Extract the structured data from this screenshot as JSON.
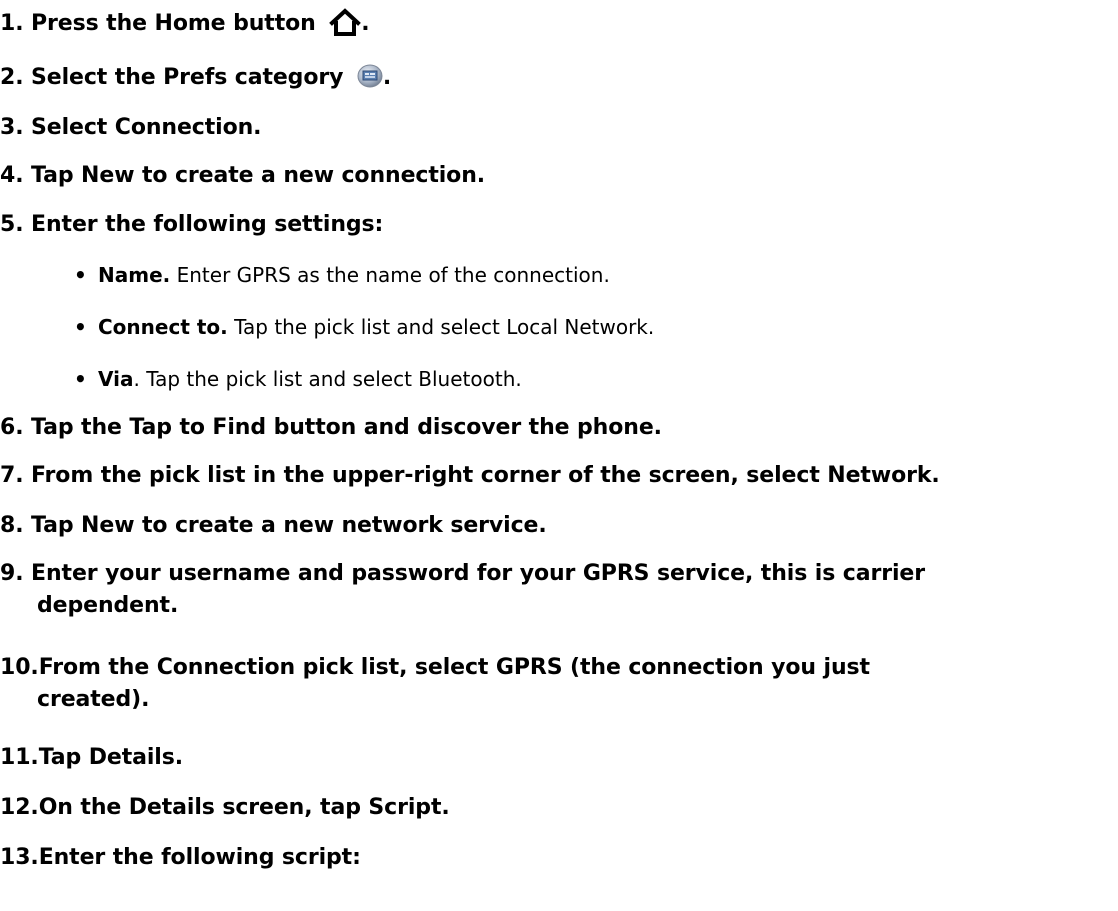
{
  "steps": [
    {
      "num": "1.",
      "text": "Press the Home button",
      "after_icon": "."
    },
    {
      "num": "2.",
      "text": "Select the Prefs category",
      "after_icon": "."
    },
    {
      "num": "3.",
      "text": "Select Connection."
    },
    {
      "num": "4.",
      "text": "Tap New to create a new connection."
    },
    {
      "num": "5.",
      "text": "Enter the following settings:"
    },
    {
      "num": "6.",
      "text": "Tap the Tap to Find button and discover the phone."
    },
    {
      "num": "7.",
      "text": "From the pick list in the upper-right corner of the screen, select Network."
    },
    {
      "num": "8.",
      "text": "Tap New to create a new network service."
    },
    {
      "num": "9.",
      "text": "Enter your username and password for your GPRS service, this is carrier",
      "text2": "dependent."
    },
    {
      "num": "10.",
      "text": "From the Connection pick list, select GPRS (the connection you just",
      "text2": "created)."
    },
    {
      "num": "11.",
      "text": "Tap Details."
    },
    {
      "num": "12.",
      "text": "On the Details screen, tap Script."
    },
    {
      "num": "13.",
      "text": "Enter the following script:"
    }
  ],
  "settings": [
    {
      "bullet": "•",
      "term": "Name.",
      "desc": " Enter GPRS as the name of the connection."
    },
    {
      "bullet": "•",
      "term": "Connect to.",
      "desc": " Tap the pick list and select Local Network."
    },
    {
      "bullet": "•",
      "term": "Via",
      "desc": ". Tap the pick list and select Bluetooth."
    }
  ],
  "icons": {
    "home": "home-icon",
    "prefs": "prefs-category-icon",
    "accent": "#5a7fb0"
  }
}
